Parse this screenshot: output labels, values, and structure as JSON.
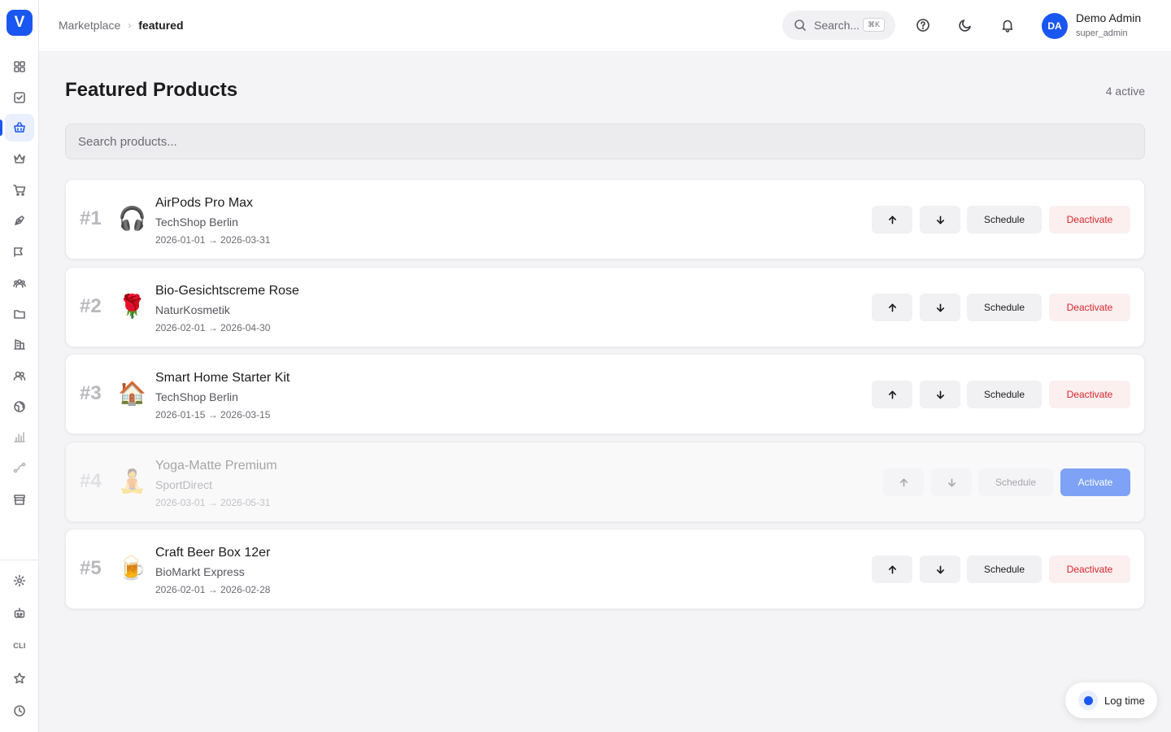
{
  "app": {
    "logo_letter": "V"
  },
  "sidebar": {
    "items": [
      {
        "icon": "grid-icon"
      },
      {
        "icon": "checkbox-icon"
      },
      {
        "icon": "shopping-basket-icon",
        "active": true
      },
      {
        "icon": "crown-icon"
      },
      {
        "icon": "cart-icon"
      },
      {
        "icon": "pen-tool-icon"
      },
      {
        "icon": "megaphone-icon"
      },
      {
        "icon": "users-group-icon"
      },
      {
        "icon": "folder-icon"
      },
      {
        "icon": "building-icon"
      },
      {
        "icon": "users-icon"
      },
      {
        "icon": "globe-icon"
      },
      {
        "icon": "bar-chart-icon"
      },
      {
        "icon": "route-icon"
      },
      {
        "icon": "store-icon"
      }
    ],
    "bottom": [
      {
        "icon": "gear-icon"
      },
      {
        "icon": "robot-icon"
      },
      {
        "label": "CLI"
      },
      {
        "icon": "star-icon"
      },
      {
        "icon": "clock-icon"
      }
    ]
  },
  "header": {
    "breadcrumb": [
      "Marketplace",
      "featured"
    ],
    "search_placeholder": "Search...",
    "search_shortcut": "⌘K",
    "user": {
      "initials": "DA",
      "name": "Demo Admin",
      "role": "super_admin"
    }
  },
  "main": {
    "title": "Featured Products",
    "active_count": "4 active",
    "search_placeholder": "Search products...",
    "products": [
      {
        "rank": "#1",
        "emoji": "🎧",
        "name": "AirPods Pro Max",
        "vendor": "TechShop Berlin",
        "dates": "2026-01-01 → 2026-03-31",
        "schedule_label": "Schedule",
        "action_label": "Deactivate",
        "active": true
      },
      {
        "rank": "#2",
        "emoji": "🌹",
        "name": "Bio-Gesichtscreme Rose",
        "vendor": "NaturKosmetik",
        "dates": "2026-02-01 → 2026-04-30",
        "schedule_label": "Schedule",
        "action_label": "Deactivate",
        "active": true
      },
      {
        "rank": "#3",
        "emoji": "🏠",
        "name": "Smart Home Starter Kit",
        "vendor": "TechShop Berlin",
        "dates": "2026-01-15 → 2026-03-15",
        "schedule_label": "Schedule",
        "action_label": "Deactivate",
        "active": true
      },
      {
        "rank": "#4",
        "emoji": "🧘",
        "name": "Yoga-Matte Premium",
        "vendor": "SportDirect",
        "dates": "2026-03-01 → 2026-05-31",
        "schedule_label": "Schedule",
        "action_label": "Activate",
        "active": false
      },
      {
        "rank": "#5",
        "emoji": "🍺",
        "name": "Craft Beer Box 12er",
        "vendor": "BioMarkt Express",
        "dates": "2026-02-01 → 2026-02-28",
        "schedule_label": "Schedule",
        "action_label": "Deactivate",
        "active": true
      }
    ]
  },
  "log_time": {
    "label": "Log time"
  },
  "colors": {
    "accent": "#1a56f0",
    "danger": "#d6262b",
    "activate_button": "#7ea2f5"
  }
}
